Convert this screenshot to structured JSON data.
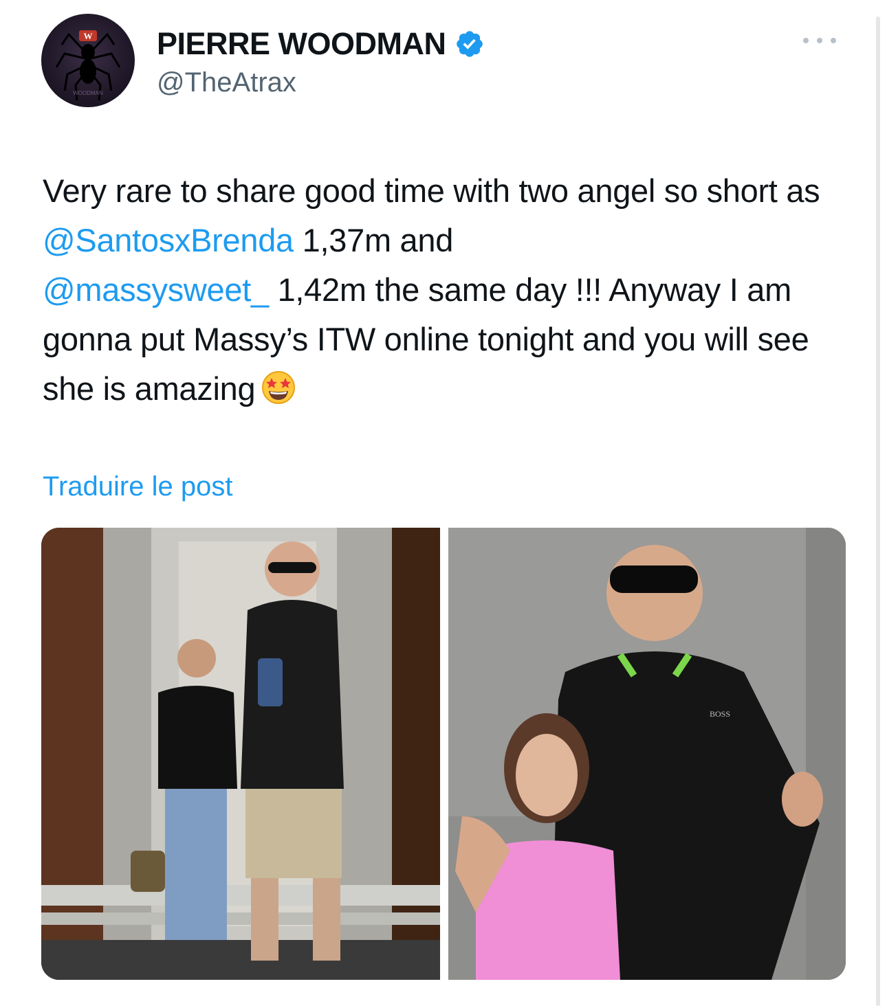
{
  "author": {
    "display_name": "PIERRE WOODMAN",
    "handle": "@TheAtrax",
    "verified": true,
    "avatar_text": "WOODMAN"
  },
  "tweet": {
    "part1": "Very rare to share good time with two angel so short as ",
    "mention1": "@SantosxBrenda",
    "part2": " 1,37m and ",
    "mention2": "@massysweet_",
    "part3": " 1,42m the same day !!! Anyway I am gonna put Massy’s ITW online tonight and you will see she is amazing",
    "emoji": "star-struck"
  },
  "translate_label": "Traduire le post",
  "media": [
    {
      "description_icon": "photo-elevator-mirror-selfie"
    },
    {
      "description_icon": "photo-posed-portrait",
      "shirt_brand": "BOSS"
    }
  ],
  "colors": {
    "link": "#1d9bf0",
    "verified": "#1d9bf0",
    "text": "#0f1419",
    "secondary": "#536471"
  }
}
